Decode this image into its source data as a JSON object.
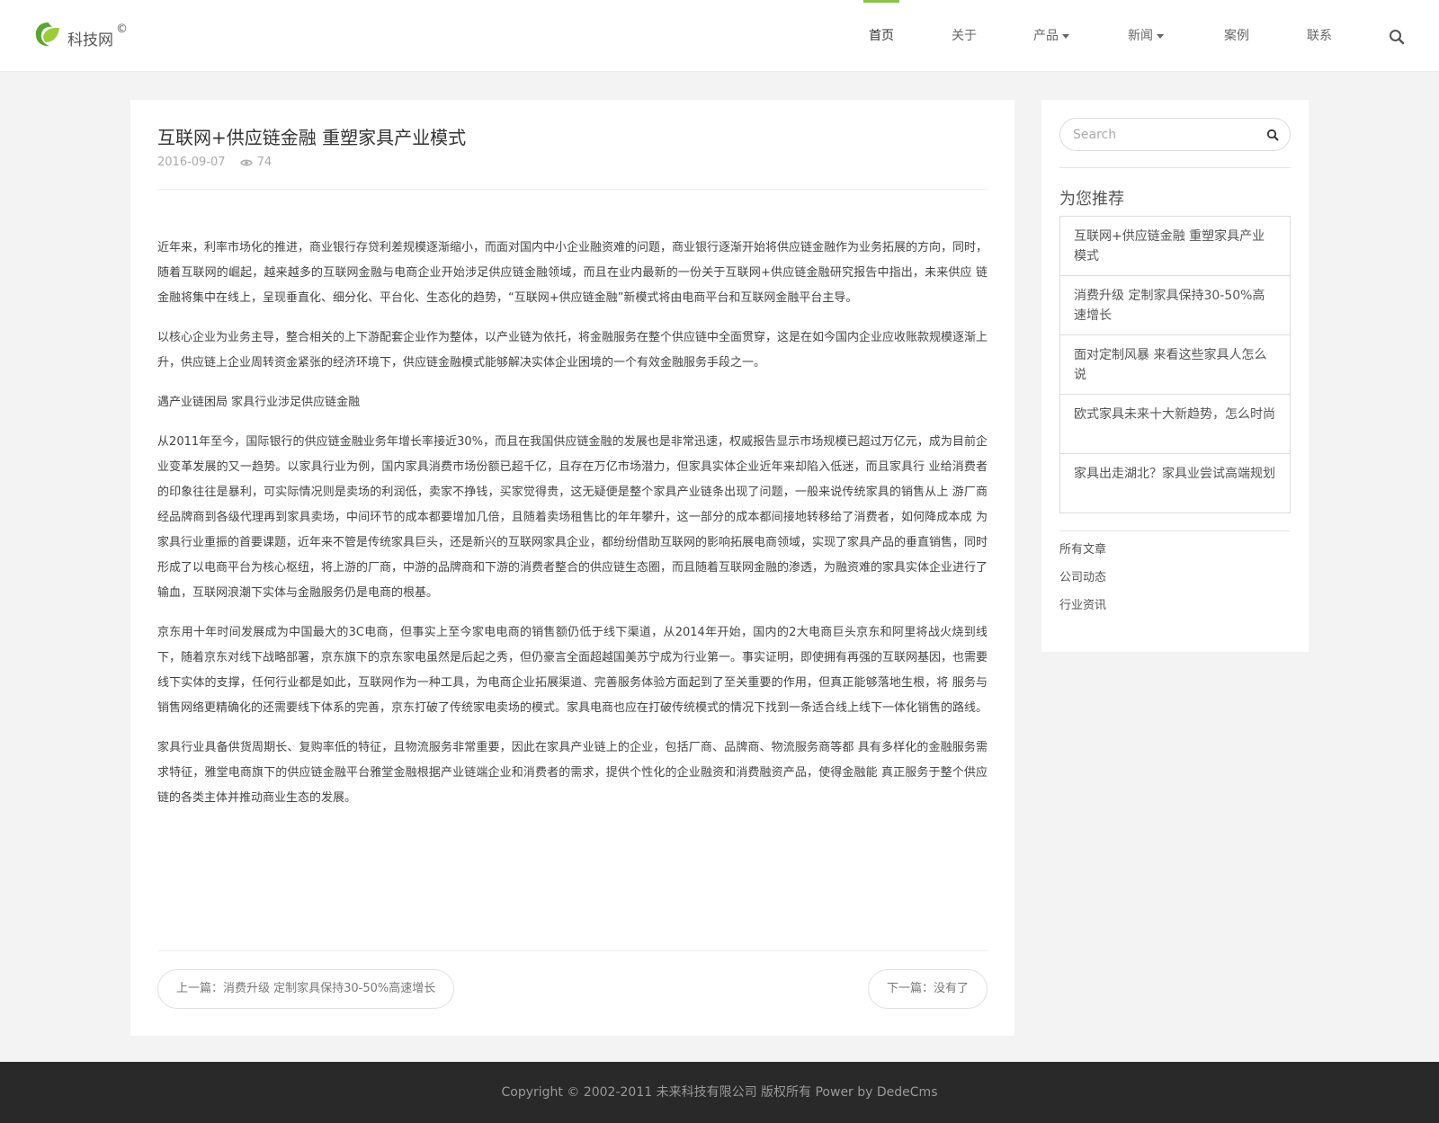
{
  "header": {
    "logo_text": "科技网",
    "logo_mark": "©",
    "nav": [
      {
        "label": "首页",
        "active": true,
        "dropdown": false
      },
      {
        "label": "关于",
        "active": false,
        "dropdown": false
      },
      {
        "label": "产品",
        "active": false,
        "dropdown": true
      },
      {
        "label": "新闻",
        "active": false,
        "dropdown": true
      },
      {
        "label": "案例",
        "active": false,
        "dropdown": false
      },
      {
        "label": "联系",
        "active": false,
        "dropdown": false
      }
    ],
    "search_icon": "search-icon"
  },
  "article": {
    "title": "互联网+供应链金融 重塑家具产业模式",
    "date": "2016-09-07",
    "views": "74",
    "paragraphs": [
      "近年来，利率市场化的推进，商业银行存贷利差规模逐渐缩小，而面对国内中小企业融资难的问题，商业银行逐渐开始将供应链金融作为业务拓展的方向，同时，随着互联网的崛起，越来越多的互联网金融与电商企业开始涉足供应链金融领域，而且在业内最新的一份关于互联网+供应链金融研究报告中指出，未来供应 链金融将集中在线上，呈现垂直化、细分化、平台化、生态化的趋势，“互联网+供应链金融”新模式将由电商平台和互联网金融平台主导。",
      "以核心企业为业务主导，整合相关的上下游配套企业作为整体，以产业链为依托，将金融服务在整个供应链中全面贯穿，这是在如今国内企业应收账款规模逐渐上升，供应链上企业周转资金紧张的经济环境下，供应链金融模式能够解决实体企业困境的一个有效金融服务手段之一。",
      "遇产业链困局 家具行业涉足供应链金融",
      "从2011年至今，国际银行的供应链金融业务年增长率接近30%，而且在我国供应链金融的发展也是非常迅速，权威报告显示市场规模已超过万亿元，成为目前企业变革发展的又一趋势。以家具行业为例，国内家具消费市场份额已超千亿，且存在万亿市场潜力，但家具实体企业近年来却陷入低迷，而且家具行 业给消费者的印象往往是暴利，可实际情况则是卖场的利润低，卖家不挣钱，买家觉得贵，这无疑便是整个家具产业链条出现了问题，一般来说传统家具的销售从上 游厂商经品牌商到各级代理再到家具卖场，中间环节的成本都要增加几倍，且随着卖场租售比的年年攀升，这一部分的成本都间接地转移给了消费者，如何降成本成 为家具行业重振的首要课题，近年来不管是传统家具巨头，还是新兴的互联网家具企业，都纷纷借助互联网的影响拓展电商领域，实现了家具产品的垂直销售，同时 形成了以电商平台为核心枢纽，将上游的厂商，中游的品牌商和下游的消费者整合的供应链生态圈，而且随着互联网金融的渗透，为融资难的家具实体企业进行了输血，互联网浪潮下实体与金融服务仍是电商的根基。",
      "京东用十年时间发展成为中国最大的3C电商，但事实上至今家电电商的销售额仍低于线下渠道，从2014年开始，国内的2大电商巨头京东和阿里将战火烧到线下，随着京东对线下战略部署，京东旗下的京东家电虽然是后起之秀，但仍豪言全面超越国美苏宁成为行业第一。事实证明，即使拥有再强的互联网基因，也需要线下实体的支撑，任何行业都是如此，互联网作为一种工具，为电商企业拓展渠道、完善服务体验方面起到了至关重要的作用，但真正能够落地生根，将 服务与销售网络更精确化的还需要线下体系的完善，京东打破了传统家电卖场的模式。家具电商也应在打破传统模式的情况下找到一条适合线上线下一体化销售的路线。",
      "家具行业具备供货周期长、复购率低的特征，且物流服务非常重要，因此在家具产业链上的企业，包括厂商、品牌商、物流服务商等都 具有多样化的金融服务需求特征，雅堂电商旗下的供应链金融平台雅堂金融根据产业链端企业和消费者的需求，提供个性化的企业融资和消费融资产品，使得金融能 真正服务于整个供应链的各类主体并推动商业生态的发展。"
    ],
    "prev_link": "上一篇：消费升级 定制家具保持30-50%高速增长",
    "next_link": "下一篇：没有了"
  },
  "sidebar": {
    "search_placeholder": "Search",
    "recommend_title": "为您推荐",
    "recommend": [
      "互联网+供应链金融 重塑家具产业模式",
      "消费升级 定制家具保持30-50%高速增长",
      "面对定制风暴 来看这些家具人怎么说",
      "欧式家具未来十大新趋势，怎么时尚",
      "家具出走湖北？家具业尝试高端规划"
    ],
    "categories": [
      "所有文章",
      "公司动态",
      "行业资讯"
    ]
  },
  "footer": {
    "copyright": "Copyright © 2002-2011 未来科技有限公司 版权所有 Power by DedeCms"
  },
  "colors": {
    "accent": "#8bc34a",
    "footer_bg": "#292929",
    "page_bg": "#f3f3f3"
  }
}
